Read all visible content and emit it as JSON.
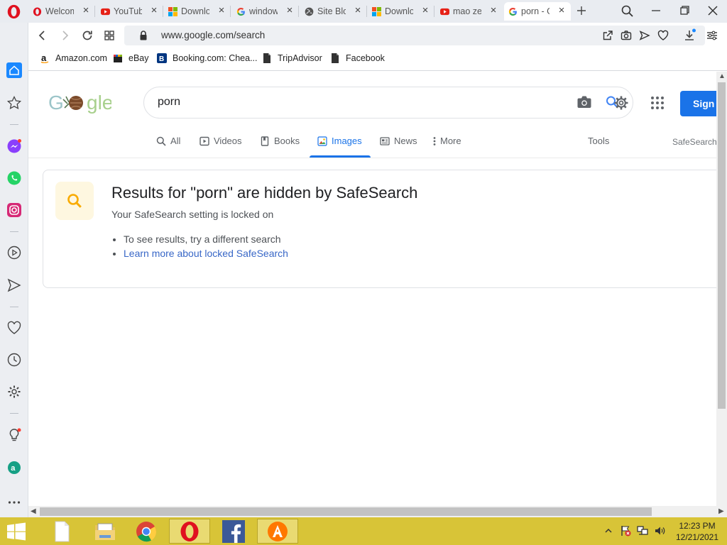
{
  "browser": {
    "tabs": [
      {
        "title": "Welcome",
        "favicon": "opera-icon"
      },
      {
        "title": "YouTube",
        "favicon": "youtube-icon"
      },
      {
        "title": "Download",
        "favicon": "windows-icon"
      },
      {
        "title": "windows",
        "favicon": "google-icon"
      },
      {
        "title": "Site Block",
        "favicon": "globe-icon"
      },
      {
        "title": "Download",
        "favicon": "windows-icon"
      },
      {
        "title": "mao zedong",
        "favicon": "youtube-icon"
      },
      {
        "title": "porn - Google",
        "favicon": "google-icon",
        "active": true
      }
    ],
    "url_display": "www.google.com/search",
    "bookmarks": [
      {
        "label": "Amazon.com",
        "icon": "amazon-icon"
      },
      {
        "label": "eBay",
        "icon": "ebay-icon"
      },
      {
        "label": "Booking.com: Chea...",
        "icon": "booking-icon"
      },
      {
        "label": "TripAdvisor",
        "icon": "page-icon"
      },
      {
        "label": "Facebook",
        "icon": "page-icon"
      }
    ]
  },
  "google": {
    "query": "porn",
    "signin_label": "Sign",
    "tabs": [
      {
        "label": "All",
        "icon": "search-icon"
      },
      {
        "label": "Videos",
        "icon": "video-icon"
      },
      {
        "label": "Books",
        "icon": "book-icon"
      },
      {
        "label": "Images",
        "icon": "image-icon",
        "active": true
      },
      {
        "label": "News",
        "icon": "news-icon"
      },
      {
        "label": "More",
        "icon": "more-vert-icon"
      }
    ],
    "tools_label": "Tools",
    "safesearch_label": "SafeSearch",
    "notice": {
      "title": "Results for \"porn\" are hidden by SafeSearch",
      "subtitle": "Your SafeSearch setting is locked on",
      "bullets": [
        {
          "text": "To see results, try a different search",
          "link": false
        },
        {
          "text": "Learn more about locked SafeSearch",
          "link": true
        }
      ]
    }
  },
  "taskbar": {
    "time": "12:23 PM",
    "date": "12/21/2021"
  },
  "colors": {
    "google_blue": "#1a73e8",
    "taskbar": "#d8c437",
    "opera_red": "#e0111f"
  }
}
